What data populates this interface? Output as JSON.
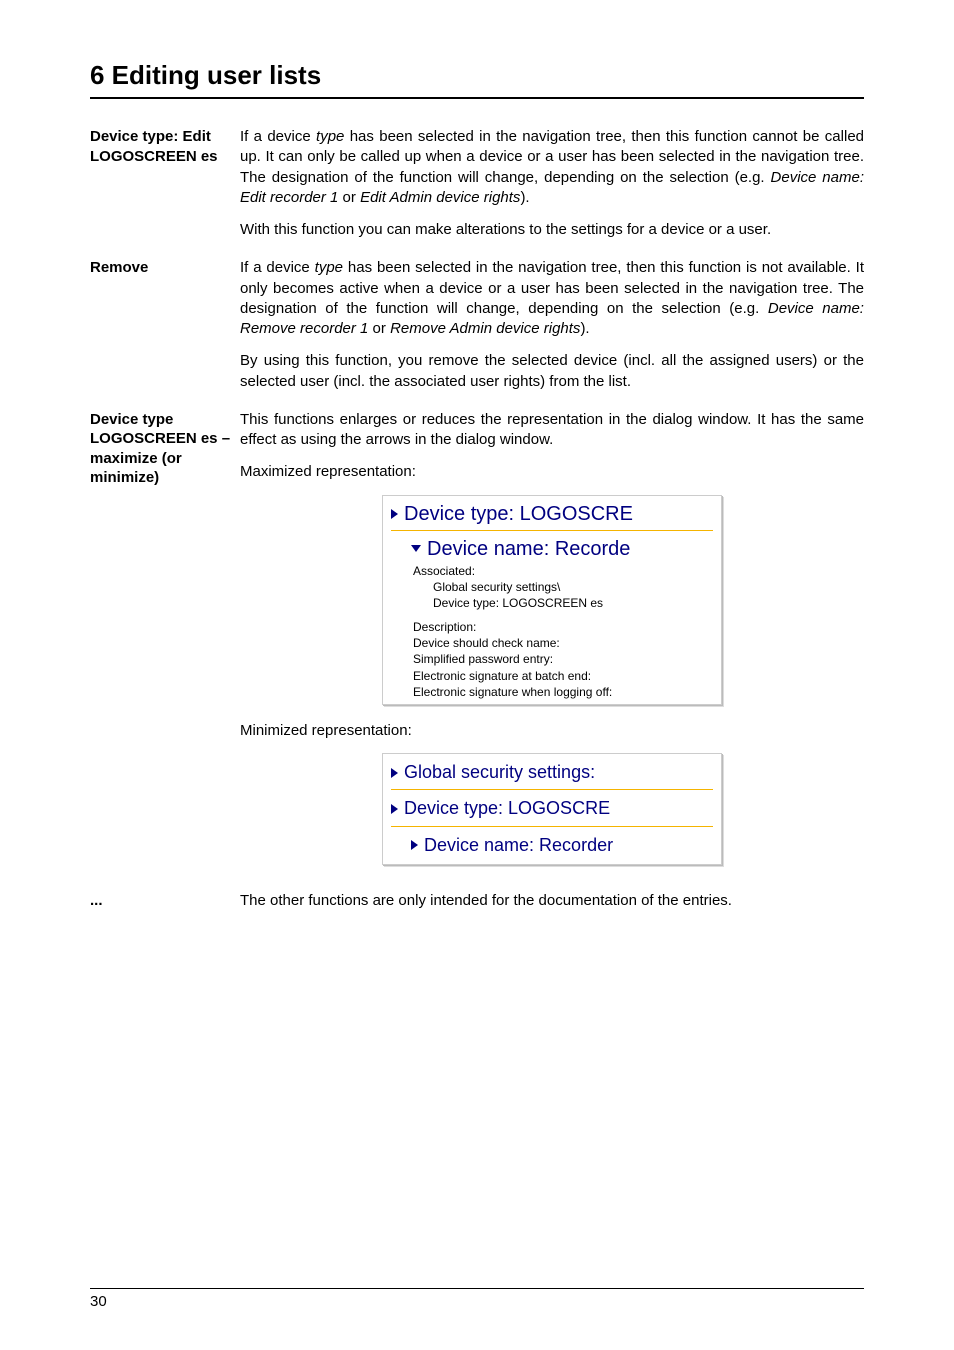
{
  "chapter_title": "6 Editing user lists",
  "sections": {
    "edit": {
      "label": "Device type: Edit LOGOSCREEN es",
      "p1_a": "If a device ",
      "p1_b": "type",
      "p1_c": " has been selected in the navigation tree, then this function cannot be called up. It can only be called up when a device or a user has been selected in the navigation tree. The designation of the function will change, depending on the selection (e.g. ",
      "p1_d": "Device name: Edit recorder 1",
      "p1_e": " or ",
      "p1_f": "Edit Admin device rights",
      "p1_g": ").",
      "p2": "With this function you can make alterations to the settings for a device or a user."
    },
    "remove": {
      "label": "Remove",
      "p1_a": "If a device ",
      "p1_b": "type",
      "p1_c": " has been selected in the navigation tree, then this function is not available. It only becomes active when a device or a user has been selected in the navigation tree. The designation of the function will change, depending on the selection (e.g. ",
      "p1_d": "Device name: Remove recorder 1",
      "p1_e": " or ",
      "p1_f": "Remove Admin device rights",
      "p1_g": ").",
      "p2": "By using this function, you remove the selected device (incl. all the assigned users) or the selected user (incl. the associated user rights) from the list."
    },
    "maximize": {
      "label": "Device type LOGOSCREEN es – maximize (or minimize)",
      "p1": "This functions enlarges or reduces the representation in the dialog window. It has the same effect as using the arrows in the dialog window.",
      "max_caption": "Maximized representation:",
      "min_caption": "Minimized representation:"
    },
    "other": {
      "label": "...",
      "p1": "The other functions are only intended for the documentation of the entries."
    }
  },
  "screenshot_max": {
    "row1": "Device type: LOGOSCRE",
    "row2": "Device name: Recorde",
    "details": {
      "assoc_label": "Associated:",
      "assoc_l1": "Global security settings\\",
      "assoc_l2": "Device type: LOGOSCREEN es",
      "desc_label": "Description:",
      "d1": "Device should check name:",
      "d2": "Simplified password entry:",
      "d3": "Electronic signature at batch end:",
      "d4": "Electronic signature when logging off:"
    }
  },
  "screenshot_min": {
    "row1": "Global security settings:",
    "row2": "Device type: LOGOSCRE",
    "row3": "Device name: Recorder"
  },
  "page_number": "30"
}
